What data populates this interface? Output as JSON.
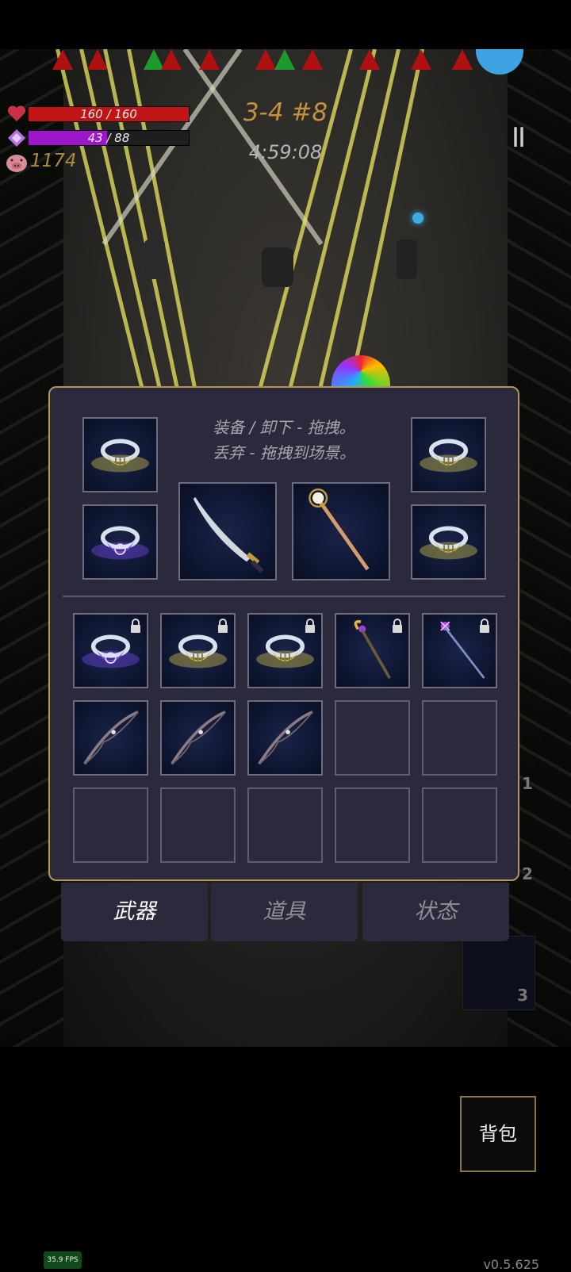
{
  "hud": {
    "hp_text": "160 / 160",
    "hp_fraction": 1.0,
    "mana_text": "43 / 88",
    "mana_fraction": 0.489,
    "coins": "1174",
    "stage": "3-4 #8",
    "timer": "4:59:08",
    "pause_symbol": "II"
  },
  "panel": {
    "hint_line1": "装备 / 卸下 - 拖拽。",
    "hint_line2": "丢弃 - 拖拽到场景。"
  },
  "equipped": [
    {
      "name": "gold-ring-icon"
    },
    {
      "name": "purple-ring-icon"
    },
    {
      "name": "curved-sword-icon"
    },
    {
      "name": "golden-staff-icon"
    },
    {
      "name": "gold-ring-icon"
    },
    {
      "name": "gold-ring-icon"
    }
  ],
  "inventory": [
    {
      "item": "purple-flower-ring-icon",
      "locked": true
    },
    {
      "item": "gold-ring-icon",
      "locked": true
    },
    {
      "item": "gold-ring-icon",
      "locked": true
    },
    {
      "item": "golden-scepter-icon",
      "locked": true
    },
    {
      "item": "violet-wand-icon",
      "locked": true
    },
    {
      "item": "longbow-icon",
      "locked": false
    },
    {
      "item": "longbow-icon",
      "locked": false
    },
    {
      "item": "longbow-icon",
      "locked": false
    },
    {
      "item": "",
      "locked": false
    },
    {
      "item": "",
      "locked": false
    },
    {
      "item": "",
      "locked": false
    },
    {
      "item": "",
      "locked": false
    },
    {
      "item": "",
      "locked": false
    },
    {
      "item": "",
      "locked": false
    },
    {
      "item": "",
      "locked": false
    }
  ],
  "tabs": [
    {
      "label": "武器",
      "active": true
    },
    {
      "label": "道具",
      "active": false
    },
    {
      "label": "状态",
      "active": false
    }
  ],
  "side_counts": [
    "1",
    "2",
    "3"
  ],
  "bag_label": "背包",
  "fps": "35.9 FPS",
  "version": "v0.5.625",
  "colors": {
    "hp": "#c11414",
    "mana": "#9b17c9",
    "accent_gold": "#b9925a",
    "panel": "#2b2a3c"
  }
}
